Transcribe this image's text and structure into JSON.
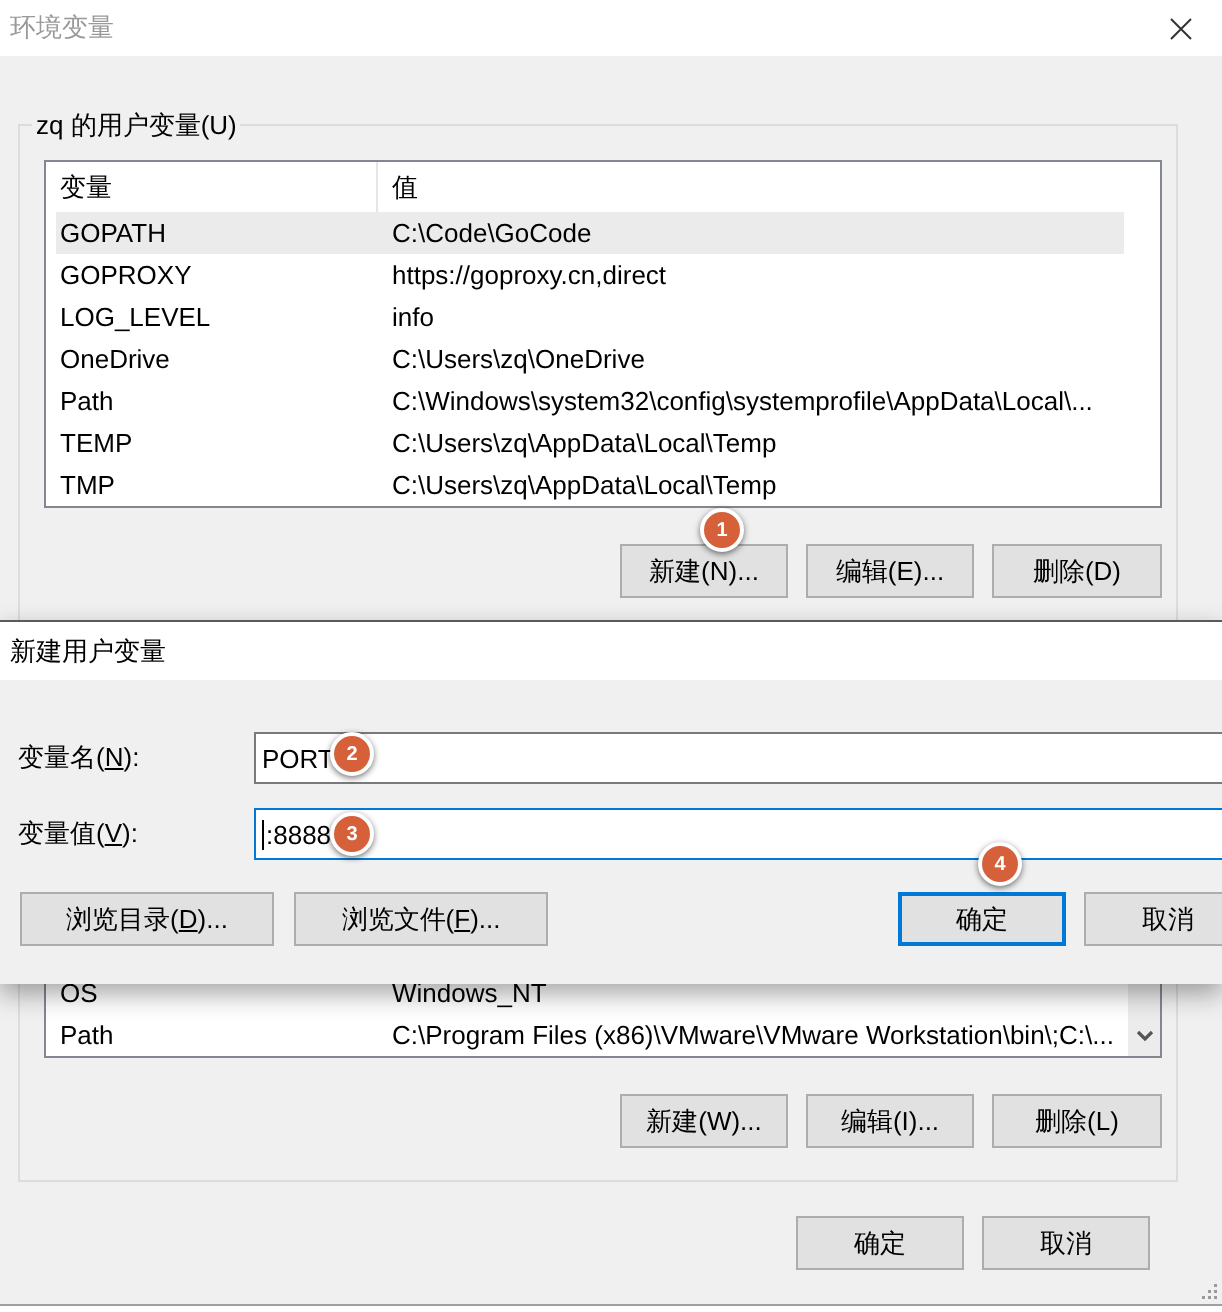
{
  "window": {
    "title": "环境变量",
    "active": false
  },
  "user_variables": {
    "title": "zq 的用户变量(U)",
    "columns": [
      "变量",
      "值"
    ],
    "rows": [
      {
        "name": "GOPATH",
        "value": "C:\\Code\\GoCode",
        "selected": true
      },
      {
        "name": "GOPROXY",
        "value": "https://goproxy.cn,direct",
        "selected": false
      },
      {
        "name": "LOG_LEVEL",
        "value": "info",
        "selected": false
      },
      {
        "name": "OneDrive",
        "value": "C:\\Users\\zq\\OneDrive",
        "selected": false
      },
      {
        "name": "Path",
        "value": "C:\\Windows\\system32\\config\\systemprofile\\AppData\\Local\\...",
        "selected": false
      },
      {
        "name": "TEMP",
        "value": "C:\\Users\\zq\\AppData\\Local\\Temp",
        "selected": false
      },
      {
        "name": "TMP",
        "value": "C:\\Users\\zq\\AppData\\Local\\Temp",
        "selected": false
      }
    ],
    "buttons": [
      {
        "label": "新建(N)...",
        "step": "1"
      },
      {
        "label": "编辑(E)..."
      },
      {
        "label": "删除(D)"
      }
    ]
  },
  "system_variables": {
    "rows": [
      {
        "name": "OS",
        "value": "Windows_NT",
        "selected": false
      },
      {
        "name": "Path",
        "value": "C:\\Program Files (x86)\\VMware\\VMware Workstation\\bin\\;C:\\...",
        "selected": false
      }
    ],
    "buttons": [
      {
        "label": "新建(W)..."
      },
      {
        "label": "编辑(I)..."
      },
      {
        "label": "删除(L)"
      }
    ]
  },
  "buttons": [
    "确定",
    "取消"
  ],
  "new_variable_dialog": {
    "title": "新建用户变量",
    "active": true,
    "fields": [
      {
        "label": "变量名(N):",
        "access_key_underlined": true,
        "value": "PORT",
        "focused": false,
        "step": "2"
      },
      {
        "label": "变量值(V):",
        "access_key_underlined": true,
        "value": ":8888",
        "focused": true,
        "step": "3"
      }
    ],
    "browse_buttons": [
      {
        "label": "浏览目录(D)...",
        "access_key_underlined": true
      },
      {
        "label": "浏览文件(F)...",
        "access_key_underlined": true
      }
    ],
    "buttons": [
      {
        "label": "确定",
        "default": true,
        "step": "4"
      },
      {
        "label": "取消",
        "default": false
      }
    ]
  }
}
